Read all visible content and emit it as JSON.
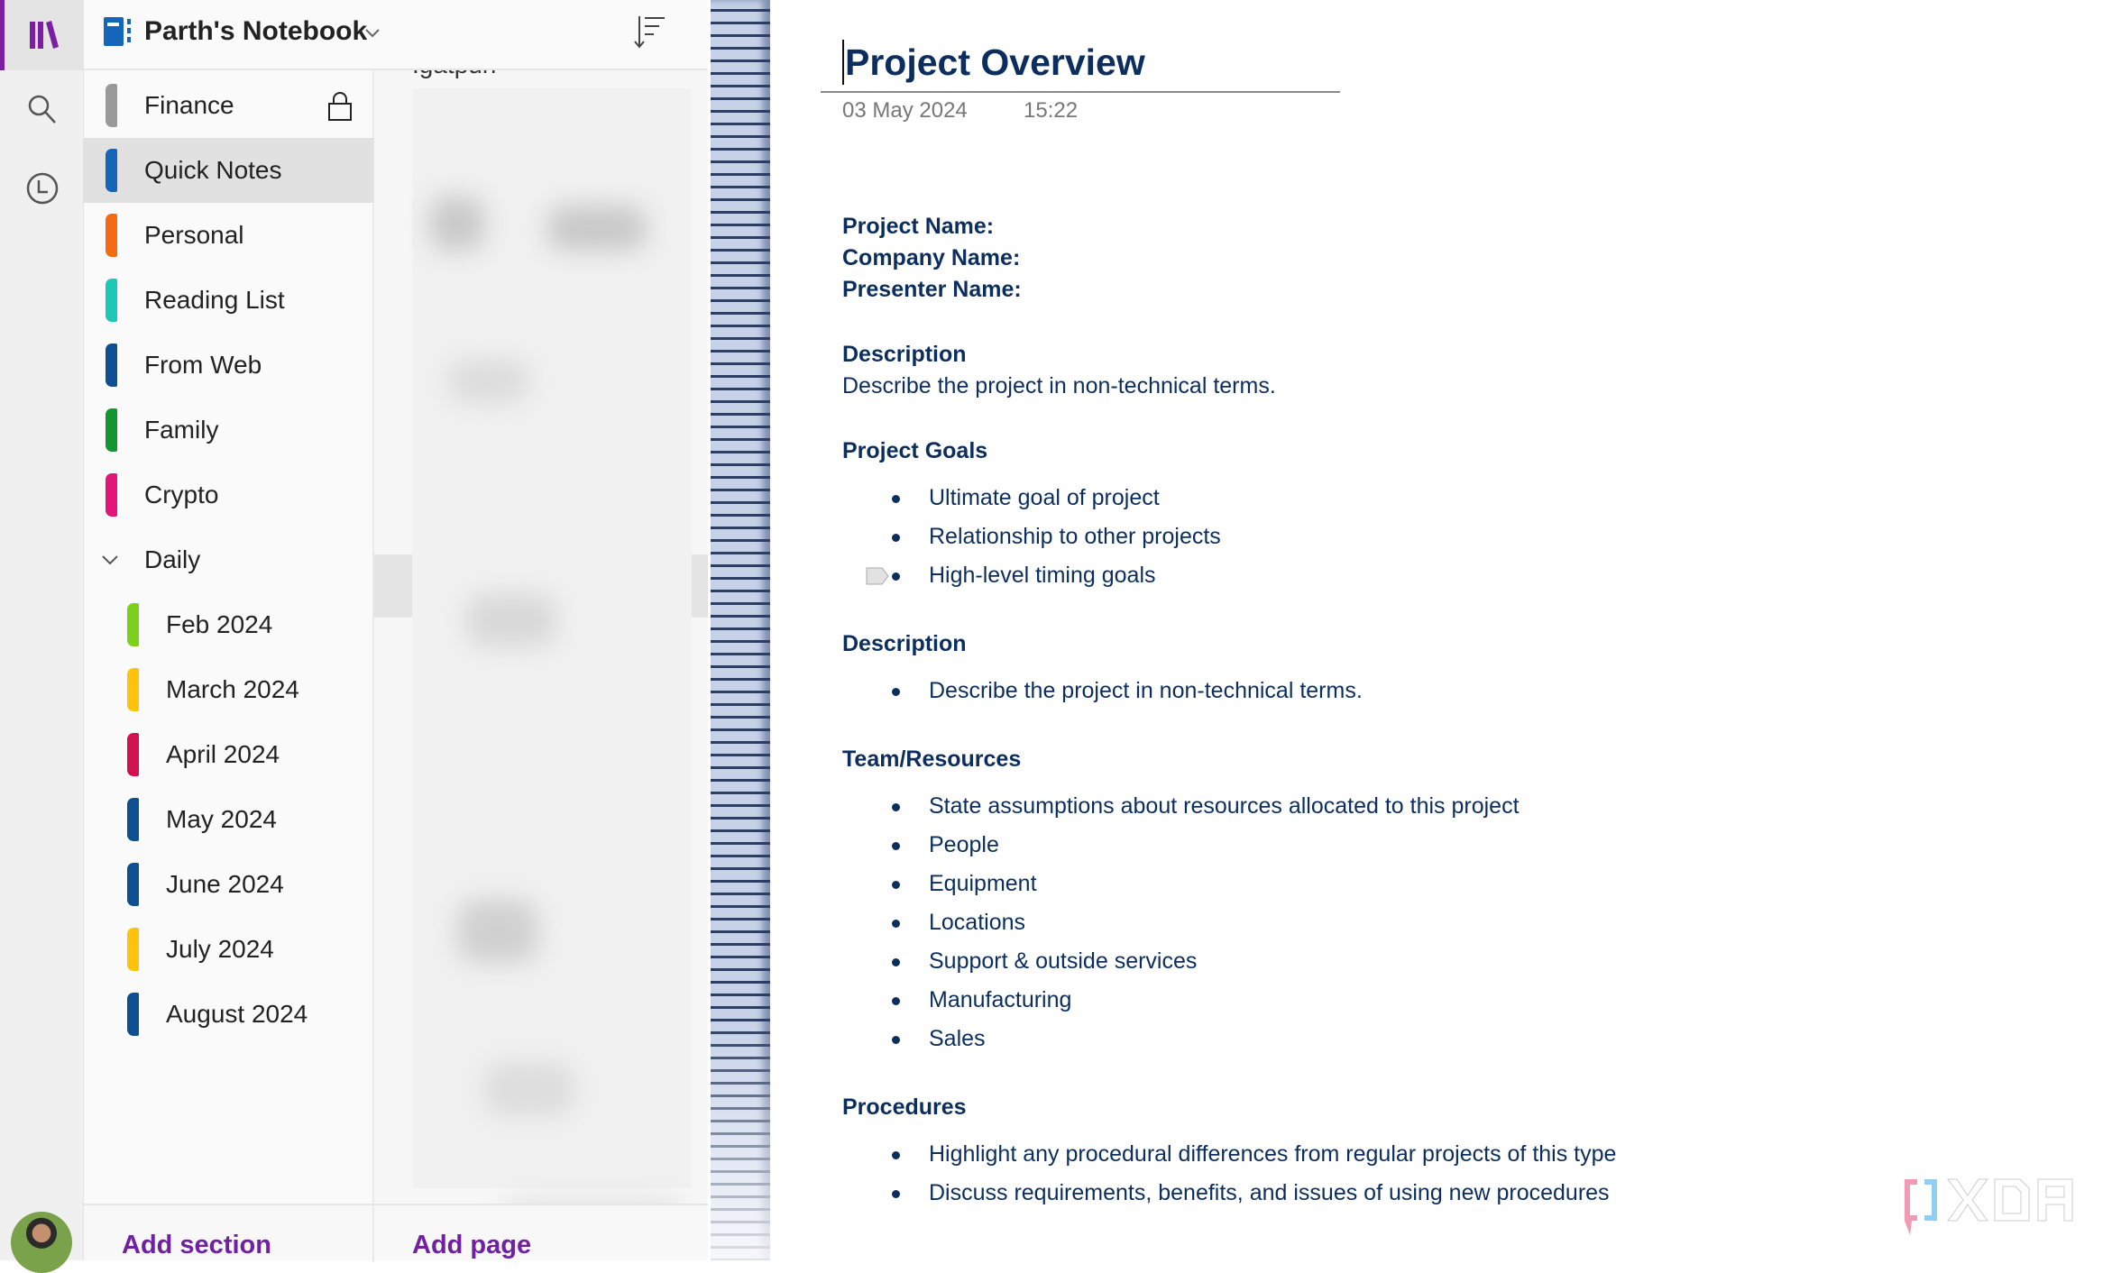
{
  "rail": {
    "icons": [
      "library-icon",
      "search-icon",
      "history-clock-icon"
    ],
    "accent": "#7a1fa2"
  },
  "header": {
    "notebook_title": "Parth's Notebook"
  },
  "sections": [
    {
      "label": "Finance",
      "color": "#9a9a9a",
      "locked": true
    },
    {
      "label": "Quick Notes",
      "color": "#1565b8",
      "selected": true
    },
    {
      "label": "Personal",
      "color": "#f56a12"
    },
    {
      "label": "Reading List",
      "color": "#1cc9b8"
    },
    {
      "label": "From Web",
      "color": "#0e4f94"
    },
    {
      "label": "Family",
      "color": "#13962f"
    },
    {
      "label": "Crypto",
      "color": "#e3147a"
    },
    {
      "label": "Daily",
      "group": true,
      "expanded": true
    },
    {
      "label": "Feb 2024",
      "color": "#7bd01e",
      "child": true
    },
    {
      "label": "March 2024",
      "color": "#ffc20e",
      "child": true
    },
    {
      "label": "April 2024",
      "color": "#d0124f",
      "child": true
    },
    {
      "label": "May 2024",
      "color": "#0e4f94",
      "child": true
    },
    {
      "label": "June 2024",
      "color": "#0e4f94",
      "child": true
    },
    {
      "label": "July 2024",
      "color": "#ffc20e",
      "child": true
    },
    {
      "label": "August 2024",
      "color": "#0e4f94",
      "child": true
    }
  ],
  "pages_panel": {
    "partial_page_title": "Igatpuri"
  },
  "footer": {
    "add_section": "Add section",
    "add_page": "Add page"
  },
  "page": {
    "title": "Project Overview",
    "date": "03 May 2024",
    "time": "15:22",
    "text_color": "#0c2e5e",
    "fields": [
      "Project Name:",
      "Company Name:",
      "Presenter Name:"
    ],
    "blocks": [
      {
        "heading": "Description",
        "text": "Describe the project in non-technical terms."
      },
      {
        "heading": "Project Goals",
        "bullets": [
          {
            "text": "Ultimate goal of project"
          },
          {
            "text": "Relationship to other projects"
          },
          {
            "text": "High-level timing goals",
            "tagged": true
          }
        ]
      },
      {
        "heading": "Description",
        "bullets": [
          {
            "text": "Describe the project in non-technical terms."
          }
        ]
      },
      {
        "heading": "Team/Resources",
        "bullets": [
          {
            "text": "State assumptions about resources allocated to this project"
          },
          {
            "text": "People"
          },
          {
            "text": "Equipment"
          },
          {
            "text": "Locations"
          },
          {
            "text": "Support & outside services"
          },
          {
            "text": "Manufacturing"
          },
          {
            "text": "Sales"
          }
        ]
      },
      {
        "heading": "Procedures",
        "bullets": [
          {
            "text": "Highlight any procedural differences from regular projects of this type"
          },
          {
            "text": "Discuss requirements, benefits, and issues of using new procedures"
          }
        ]
      }
    ]
  },
  "watermark": {
    "text": "XDA"
  }
}
